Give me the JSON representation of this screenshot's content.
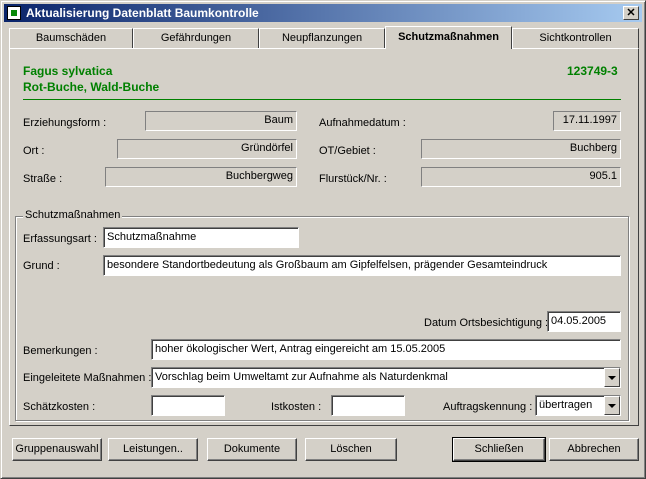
{
  "window": {
    "title": "Aktualisierung Datenblatt Baumkontrolle",
    "close_label": "✕"
  },
  "tabs": [
    {
      "label": "Baumschäden",
      "active": false
    },
    {
      "label": "Gefährdungen",
      "active": false
    },
    {
      "label": "Neupflanzungen",
      "active": false
    },
    {
      "label": "Schutzmaßnahmen",
      "active": true
    },
    {
      "label": "Sichtkontrollen",
      "active": false
    }
  ],
  "header": {
    "botanical_name": "Fagus sylvatica",
    "common_name": "Rot-Buche, Wald-Buche",
    "tree_id": "123749-3"
  },
  "info": {
    "erziehungsform_label": "Erziehungsform :",
    "erziehungsform_value": "Baum",
    "aufnahmedatum_label": "Aufnahmedatum :",
    "aufnahmedatum_value": "17.11.1997",
    "ort_label": "Ort :",
    "ort_value": "Gründörfel",
    "ot_label": "OT/Gebiet :",
    "ot_value": "Buchberg",
    "strasse_label": "Straße :",
    "strasse_value": "Buchbergweg",
    "flurstueck_label": "Flurstück/Nr. :",
    "flurstueck_value": "905.1"
  },
  "schutz": {
    "group_label": "Schutzmaßnahmen",
    "erfassungsart_label": "Erfassungsart :",
    "erfassungsart_value": "Schutzmaßnahme",
    "grund_label": "Grund :",
    "grund_value": "besondere Standortbedeutung als Großbaum am Gipfelfelsen, prägender Gesamteindruck",
    "datum_label": "Datum Ortsbesichtigung :",
    "datum_value": "04.05.2005",
    "bemerkungen_label": "Bemerkungen :",
    "bemerkungen_value": "hoher ökologischer Wert, Antrag eingereicht am 15.05.2005",
    "massnahmen_label": "Eingeleitete Maßnahmen :",
    "massnahmen_value": "Vorschlag beim Umweltamt zur Aufnahme als Naturdenkmal",
    "schaetzkosten_label": "Schätzkosten :",
    "schaetzkosten_value": "",
    "istkosten_label": "Istkosten :",
    "istkosten_value": "",
    "auftrag_label": "Auftragskennung :",
    "auftrag_value": "übertragen"
  },
  "buttons": {
    "gruppenauswahl": "Gruppenauswahl",
    "leistungen": "Leistungen..",
    "dokumente": "Dokumente",
    "loeschen": "Löschen",
    "schliessen": "Schließen",
    "abbrechen": "Abbrechen"
  },
  "colors": {
    "accent_green": "#008000",
    "title_bar": "#0a246a"
  }
}
